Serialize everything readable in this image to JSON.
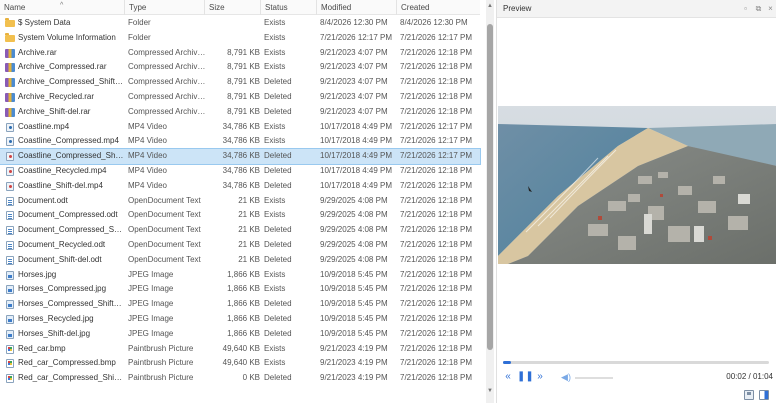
{
  "columns": {
    "name": "Name",
    "type": "Type",
    "size": "Size",
    "status": "Status",
    "modified": "Modified",
    "created": "Created"
  },
  "files": [
    {
      "icon": "folder-icon",
      "kind": "folder",
      "name": "$ System Data",
      "type": "Folder",
      "size": "",
      "status": "Exists",
      "modified": "8/4/2026 12:30 PM",
      "created": "8/4/2026 12:30 PM"
    },
    {
      "icon": "folder-icon",
      "kind": "folder",
      "name": "System Volume Information",
      "type": "Folder",
      "size": "",
      "status": "Exists",
      "modified": "7/21/2026 12:17 PM",
      "created": "7/21/2026 12:17 PM"
    },
    {
      "icon": "archive-icon",
      "kind": "rar",
      "name": "Archive.rar",
      "type": "Compressed Archive...",
      "size": "8,791 KB",
      "status": "Exists",
      "modified": "9/21/2023 4:07 PM",
      "created": "7/21/2026 12:18 PM"
    },
    {
      "icon": "archive-icon",
      "kind": "rar",
      "name": "Archive_Compressed.rar",
      "type": "Compressed Archive...",
      "size": "8,791 KB",
      "status": "Exists",
      "modified": "9/21/2023 4:07 PM",
      "created": "7/21/2026 12:18 PM"
    },
    {
      "icon": "archive-icon",
      "kind": "rar",
      "name": "Archive_Compressed_Shift-del...",
      "type": "Compressed Archive...",
      "size": "8,791 KB",
      "status": "Deleted",
      "modified": "9/21/2023 4:07 PM",
      "created": "7/21/2026 12:18 PM"
    },
    {
      "icon": "archive-icon",
      "kind": "rar",
      "name": "Archive_Recycled.rar",
      "type": "Compressed Archive...",
      "size": "8,791 KB",
      "status": "Deleted",
      "modified": "9/21/2023 4:07 PM",
      "created": "7/21/2026 12:18 PM"
    },
    {
      "icon": "archive-icon",
      "kind": "rar",
      "name": "Archive_Shift-del.rar",
      "type": "Compressed Archive...",
      "size": "8,791 KB",
      "status": "Deleted",
      "modified": "9/21/2023 4:07 PM",
      "created": "7/21/2026 12:18 PM"
    },
    {
      "icon": "video-file-icon",
      "kind": "mp4",
      "name": "Coastline.mp4",
      "type": "MP4 Video",
      "size": "34,786 KB",
      "status": "Exists",
      "modified": "10/17/2018 4:49 PM",
      "created": "7/21/2026 12:17 PM"
    },
    {
      "icon": "video-file-icon",
      "kind": "mp4",
      "name": "Coastline_Compressed.mp4",
      "type": "MP4 Video",
      "size": "34,786 KB",
      "status": "Exists",
      "modified": "10/17/2018 4:49 PM",
      "created": "7/21/2026 12:17 PM"
    },
    {
      "icon": "video-file-icon",
      "kind": "mp4 red",
      "name": "Coastline_Compressed_Shift-d...",
      "type": "MP4 Video",
      "size": "34,786 KB",
      "status": "Deleted",
      "modified": "10/17/2018 4:49 PM",
      "created": "7/21/2026 12:17 PM",
      "selected": true
    },
    {
      "icon": "video-file-icon",
      "kind": "mp4 red",
      "name": "Coastline_Recycled.mp4",
      "type": "MP4 Video",
      "size": "34,786 KB",
      "status": "Deleted",
      "modified": "10/17/2018 4:49 PM",
      "created": "7/21/2026 12:18 PM"
    },
    {
      "icon": "video-file-icon",
      "kind": "mp4 red",
      "name": "Coastline_Shift-del.mp4",
      "type": "MP4 Video",
      "size": "34,786 KB",
      "status": "Deleted",
      "modified": "10/17/2018 4:49 PM",
      "created": "7/21/2026 12:18 PM"
    },
    {
      "icon": "document-file-icon",
      "kind": "odt",
      "name": "Document.odt",
      "type": "OpenDocument Text",
      "size": "21 KB",
      "status": "Exists",
      "modified": "9/29/2025 4:08 PM",
      "created": "7/21/2026 12:18 PM"
    },
    {
      "icon": "document-file-icon",
      "kind": "odt",
      "name": "Document_Compressed.odt",
      "type": "OpenDocument Text",
      "size": "21 KB",
      "status": "Exists",
      "modified": "9/29/2025 4:08 PM",
      "created": "7/21/2026 12:18 PM"
    },
    {
      "icon": "document-file-icon",
      "kind": "odt",
      "name": "Document_Compressed_Shift-...",
      "type": "OpenDocument Text",
      "size": "21 KB",
      "status": "Deleted",
      "modified": "9/29/2025 4:08 PM",
      "created": "7/21/2026 12:18 PM"
    },
    {
      "icon": "document-file-icon",
      "kind": "odt",
      "name": "Document_Recycled.odt",
      "type": "OpenDocument Text",
      "size": "21 KB",
      "status": "Deleted",
      "modified": "9/29/2025 4:08 PM",
      "created": "7/21/2026 12:18 PM"
    },
    {
      "icon": "document-file-icon",
      "kind": "odt",
      "name": "Document_Shift-del.odt",
      "type": "OpenDocument Text",
      "size": "21 KB",
      "status": "Deleted",
      "modified": "9/29/2025 4:08 PM",
      "created": "7/21/2026 12:18 PM"
    },
    {
      "icon": "image-file-icon",
      "kind": "jpg",
      "name": "Horses.jpg",
      "type": "JPEG Image",
      "size": "1,866 KB",
      "status": "Exists",
      "modified": "10/9/2018 5:45 PM",
      "created": "7/21/2026 12:18 PM"
    },
    {
      "icon": "image-file-icon",
      "kind": "jpg",
      "name": "Horses_Compressed.jpg",
      "type": "JPEG Image",
      "size": "1,866 KB",
      "status": "Exists",
      "modified": "10/9/2018 5:45 PM",
      "created": "7/21/2026 12:18 PM"
    },
    {
      "icon": "image-file-icon",
      "kind": "jpg",
      "name": "Horses_Compressed_Shift-del...",
      "type": "JPEG Image",
      "size": "1,866 KB",
      "status": "Deleted",
      "modified": "10/9/2018 5:45 PM",
      "created": "7/21/2026 12:18 PM"
    },
    {
      "icon": "image-file-icon",
      "kind": "jpg",
      "name": "Horses_Recycled.jpg",
      "type": "JPEG Image",
      "size": "1,866 KB",
      "status": "Deleted",
      "modified": "10/9/2018 5:45 PM",
      "created": "7/21/2026 12:18 PM"
    },
    {
      "icon": "image-file-icon",
      "kind": "jpg",
      "name": "Horses_Shift-del.jpg",
      "type": "JPEG Image",
      "size": "1,866 KB",
      "status": "Deleted",
      "modified": "10/9/2018 5:45 PM",
      "created": "7/21/2026 12:18 PM"
    },
    {
      "icon": "bitmap-file-icon",
      "kind": "bmp",
      "name": "Red_car.bmp",
      "type": "Paintbrush Picture",
      "size": "49,640 KB",
      "status": "Exists",
      "modified": "9/21/2023 4:19 PM",
      "created": "7/21/2026 12:18 PM"
    },
    {
      "icon": "bitmap-file-icon",
      "kind": "bmp",
      "name": "Red_car_Compressed.bmp",
      "type": "Paintbrush Picture",
      "size": "49,640 KB",
      "status": "Exists",
      "modified": "9/21/2023 4:19 PM",
      "created": "7/21/2026 12:18 PM"
    },
    {
      "icon": "bitmap-file-icon",
      "kind": "bmp",
      "name": "Red_car_Compressed_Shift-del...",
      "type": "Paintbrush Picture",
      "size": "0 KB",
      "status": "Deleted",
      "modified": "9/21/2023 4:19 PM",
      "created": "7/21/2026 12:18 PM"
    }
  ],
  "preview": {
    "title": "Preview",
    "window_buttons": [
      "restore-icon",
      "popout-icon",
      "close-icon"
    ],
    "video_subject": "aerial coastline video frame",
    "progress_fraction": 0.03,
    "time": "00:02 / 01:04",
    "controls": [
      "rewind-icon",
      "pause-icon",
      "fast-forward-icon",
      "volume-icon"
    ],
    "footer_icons": [
      "save-icon",
      "panel-layout-icon"
    ]
  },
  "colors": {
    "selection": "#cce4f7",
    "accent": "#2e6fd6",
    "folder": "#f2c04f"
  }
}
